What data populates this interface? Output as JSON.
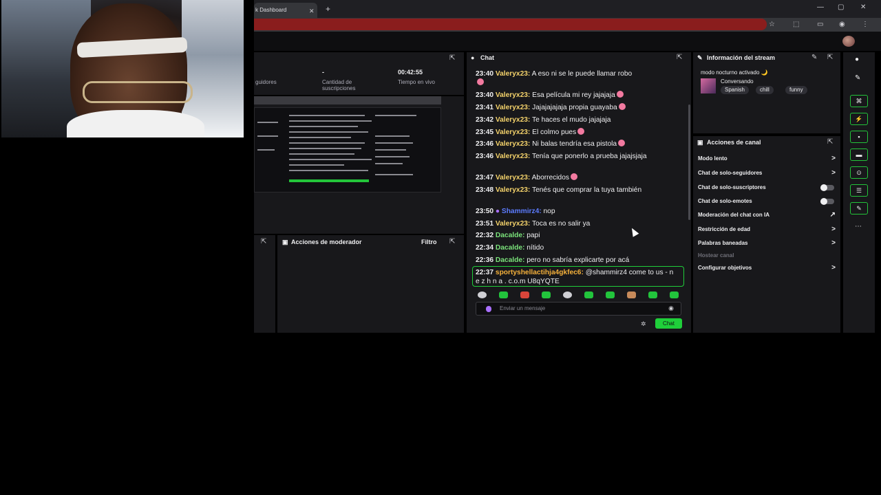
{
  "browser": {
    "tab_title": "k Dashboard",
    "tab_close": "✕",
    "new_tab": "+",
    "window_controls": [
      "—",
      "▢",
      "✕"
    ]
  },
  "stats": {
    "followers_label": "guidores",
    "subs_value": "-",
    "subs_label_1": "Cantidad de",
    "subs_label_2": "suscripciones",
    "live_time_value": "00:42:55",
    "live_time_label": "Tiempo en vivo"
  },
  "moderator": {
    "title": "Acciones de moderador",
    "filter": "Filtro"
  },
  "chat": {
    "title": "Chat",
    "messages": [
      {
        "time": "23:40",
        "user": "Valeryx23:",
        "color": "#f5d36b",
        "text": "A eso ni se le puede llamar robo"
      },
      {
        "time": "23:40",
        "user": "Valeryx23:",
        "color": "#f5d36b",
        "text": "Esa película mi rey jajajaja"
      },
      {
        "time": "23:41",
        "user": "Valeryx23:",
        "color": "#f5d36b",
        "text": "Jajajajajaja propia guayaba"
      },
      {
        "time": "23:42",
        "user": "Valeryx23:",
        "color": "#f5d36b",
        "text": "Te haces el mudo jajajaja"
      },
      {
        "time": "23:45",
        "user": "Valeryx23:",
        "color": "#f5d36b",
        "text": "El colmo pues"
      },
      {
        "time": "23:46",
        "user": "Valeryx23:",
        "color": "#f5d36b",
        "text": "Ni balas tendría esa pistola"
      },
      {
        "time": "23:46",
        "user": "Valeryx23:",
        "color": "#f5d36b",
        "text": "Tenía que ponerlo a prueba jajajsjaja"
      },
      {
        "time": "23:47",
        "user": "Valeryx23:",
        "color": "#f5d36b",
        "text": "Aborrecidos"
      },
      {
        "time": "23:48",
        "user": "Valeryx23:",
        "color": "#f5d36b",
        "text": "Tenés que comprar la tuya también"
      },
      {
        "time": "23:50",
        "user": "Shammirz4:",
        "color": "#5c7cff",
        "text": "nop"
      },
      {
        "time": "23:51",
        "user": "Valeryx23:",
        "color": "#f5d36b",
        "text": "Toca es no salir ya"
      },
      {
        "time": "22:32",
        "user": "Dacalde:",
        "color": "#7be37b",
        "text": "papi"
      },
      {
        "time": "22:34",
        "user": "Dacalde:",
        "color": "#7be37b",
        "text": "nítido"
      },
      {
        "time": "22:36",
        "user": "Dacalde:",
        "color": "#7be37b",
        "text": "pero no sabría explicarte por acá"
      },
      {
        "time": "22:37",
        "user": "sportyshellactihja4gkfec6:",
        "color": "#f5b13b",
        "text": "@shammirz4 come to us - n e z h n a . c.o.m U8qYQTE"
      }
    ],
    "input_placeholder": "Enviar un mensaje",
    "send_label": "Chat"
  },
  "stream_info": {
    "title": "Información del stream",
    "stream_title": "modo nocturno activado 🌙",
    "category": "Conversando",
    "tags": [
      "Spanish",
      "chill",
      "funny"
    ]
  },
  "channel_actions": {
    "title": "Acciones de canal",
    "rows": [
      {
        "label": "Modo lento",
        "control": "chevron"
      },
      {
        "label": "Chat de solo-seguidores",
        "control": "chevron"
      },
      {
        "label": "Chat de solo-suscriptores",
        "control": "toggle"
      },
      {
        "label": "Chat de solo-emotes",
        "control": "toggle"
      },
      {
        "label": "Moderación del chat con IA",
        "control": "chart"
      },
      {
        "label": "Restricción de edad",
        "control": "chevron"
      },
      {
        "label": "Palabras baneadas",
        "control": "chevron"
      },
      {
        "label": "Hostear canal",
        "control": "none"
      },
      {
        "label": "Configurar objetivos",
        "control": "chevron"
      }
    ]
  },
  "colors": {
    "accent_green": "#1fcf3a",
    "panel_bg": "#18181b",
    "page_bg": "#0e0e10"
  }
}
